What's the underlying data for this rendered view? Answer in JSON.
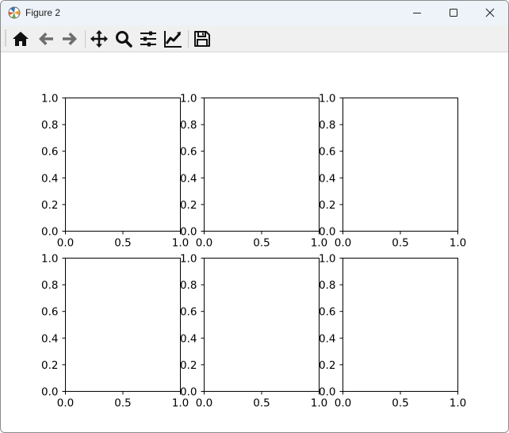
{
  "window": {
    "title": "Figure 2",
    "icon": "matplotlib-logo-icon",
    "controls": [
      "minimize-icon",
      "maximize-icon",
      "close-icon"
    ]
  },
  "toolbar": {
    "buttons": [
      {
        "name": "home-button",
        "icon": "home-icon"
      },
      {
        "name": "back-button",
        "icon": "arrow-left-icon"
      },
      {
        "name": "forward-button",
        "icon": "arrow-right-icon"
      },
      {
        "name": "pan-button",
        "icon": "move-icon"
      },
      {
        "name": "zoom-button",
        "icon": "magnifier-icon"
      },
      {
        "name": "configure-subplots-button",
        "icon": "sliders-icon"
      },
      {
        "name": "edit-axes-button",
        "icon": "line-chart-icon"
      },
      {
        "name": "save-button",
        "icon": "floppy-disk-icon"
      }
    ]
  },
  "figure": {
    "rows": 2,
    "cols": 3,
    "xticks": [
      "0.0",
      "0.5",
      "1.0"
    ],
    "yticks": [
      "0.0",
      "0.2",
      "0.4",
      "0.6",
      "0.8",
      "1.0"
    ]
  },
  "chart_data": [
    {
      "type": "line",
      "series": [],
      "xlim": [
        0.0,
        1.0
      ],
      "ylim": [
        0.0,
        1.0
      ],
      "grid": false
    },
    {
      "type": "line",
      "series": [],
      "xlim": [
        0.0,
        1.0
      ],
      "ylim": [
        0.0,
        1.0
      ],
      "grid": false
    },
    {
      "type": "line",
      "series": [],
      "xlim": [
        0.0,
        1.0
      ],
      "ylim": [
        0.0,
        1.0
      ],
      "grid": false
    },
    {
      "type": "line",
      "series": [],
      "xlim": [
        0.0,
        1.0
      ],
      "ylim": [
        0.0,
        1.0
      ],
      "grid": false
    },
    {
      "type": "line",
      "series": [],
      "xlim": [
        0.0,
        1.0
      ],
      "ylim": [
        0.0,
        1.0
      ],
      "grid": false
    },
    {
      "type": "line",
      "series": [],
      "xlim": [
        0.0,
        1.0
      ],
      "ylim": [
        0.0,
        1.0
      ],
      "grid": false
    }
  ]
}
